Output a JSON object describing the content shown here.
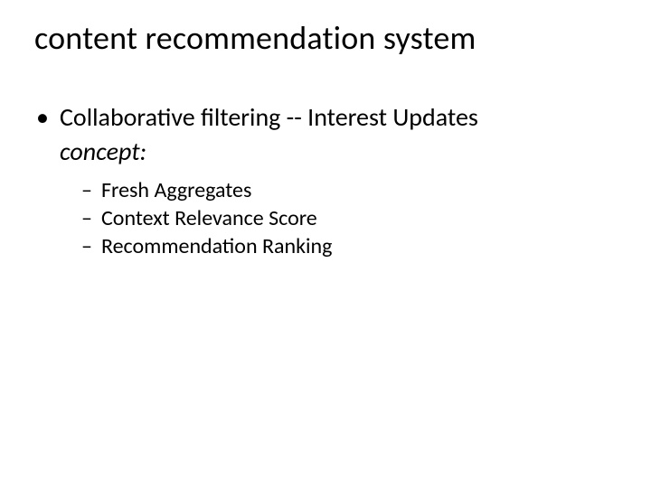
{
  "title": "content recommendation system",
  "bullet1": {
    "label": "Collaborative filtering -- Interest Updates",
    "concept": "concept:",
    "subitems": [
      "Fresh Aggregates",
      "Context Relevance Score",
      "Recommendation Ranking"
    ]
  }
}
